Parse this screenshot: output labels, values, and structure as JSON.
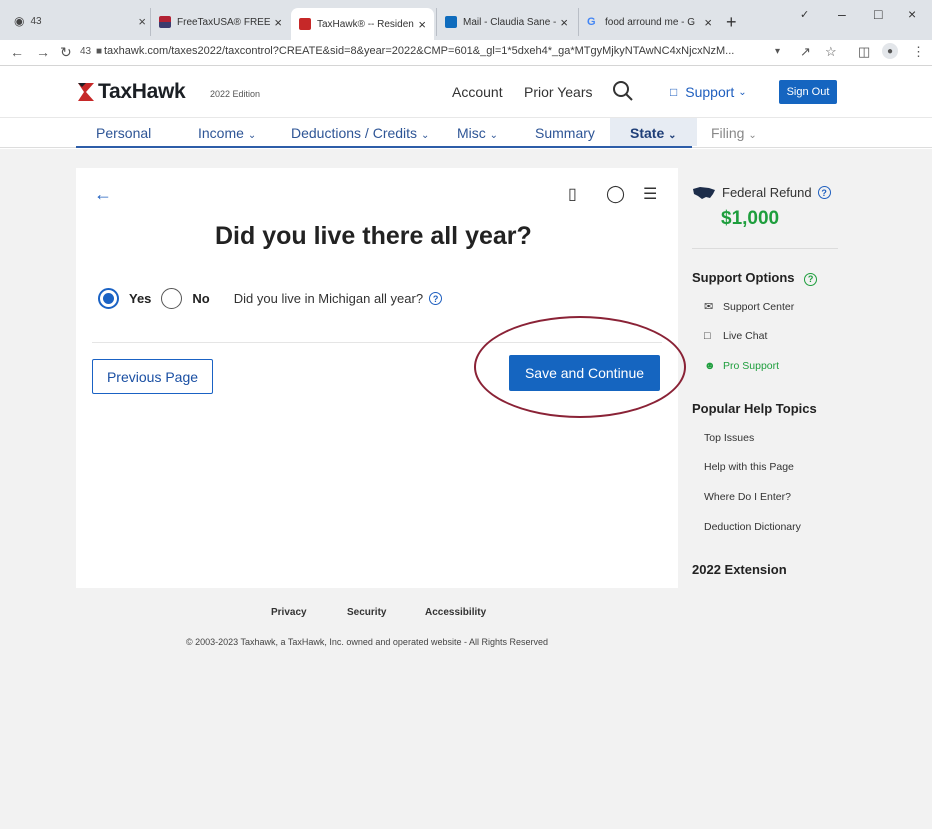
{
  "browser": {
    "ext_tab_label": "43",
    "tabs": [
      {
        "title": "FreeTaxUSA® FREE Ta",
        "active": false
      },
      {
        "title": "TaxHawk® -- Residen",
        "active": true
      },
      {
        "title": "Mail - Claudia Sane -",
        "active": false
      },
      {
        "title": "food arround me - G",
        "active": false
      }
    ],
    "address_count": "43",
    "url": "taxhawk.com/taxes2022/taxcontrol?CREATE&sid=8&year=2022&CMP=601&_gl=1*5dxeh4*_ga*MTgyMjkyNTAwNC4xNjcxNzM..."
  },
  "header": {
    "logo_text": "TaxHawk",
    "edition": "2022 Edition",
    "account": "Account",
    "prior_years": "Prior Years",
    "support": "Support",
    "sign_out": "Sign Out"
  },
  "nav": {
    "items": [
      "Personal",
      "Income",
      "Deductions / Credits",
      "Misc",
      "Summary",
      "State",
      "Filing"
    ],
    "active": "State"
  },
  "main": {
    "question": "Did you live there all year?",
    "yes_label": "Yes",
    "no_label": "No",
    "selected": "Yes",
    "sub_question": "Did you live in Michigan all year?",
    "prev_button": "Previous Page",
    "save_button": "Save and Continue"
  },
  "rail": {
    "refund_label": "Federal Refund",
    "refund_amount": "$1,000",
    "support_heading": "Support Options",
    "support_items": [
      "Support Center",
      "Live Chat",
      "Pro Support"
    ],
    "help_heading": "Popular Help Topics",
    "help_items": [
      "Top Issues",
      "Help with this Page",
      "Where Do I Enter?",
      "Deduction Dictionary"
    ],
    "extension_heading": "2022 Extension"
  },
  "footer": {
    "links": [
      "Privacy",
      "Security",
      "Accessibility"
    ],
    "copyright": "© 2003-2023 Taxhawk, a TaxHawk, Inc. owned and operated website - All Rights Reserved"
  },
  "colors": {
    "brand_blue": "#1565c0",
    "refund_green": "#1e9e3d",
    "annotation_ellipse": "#8a2236"
  }
}
